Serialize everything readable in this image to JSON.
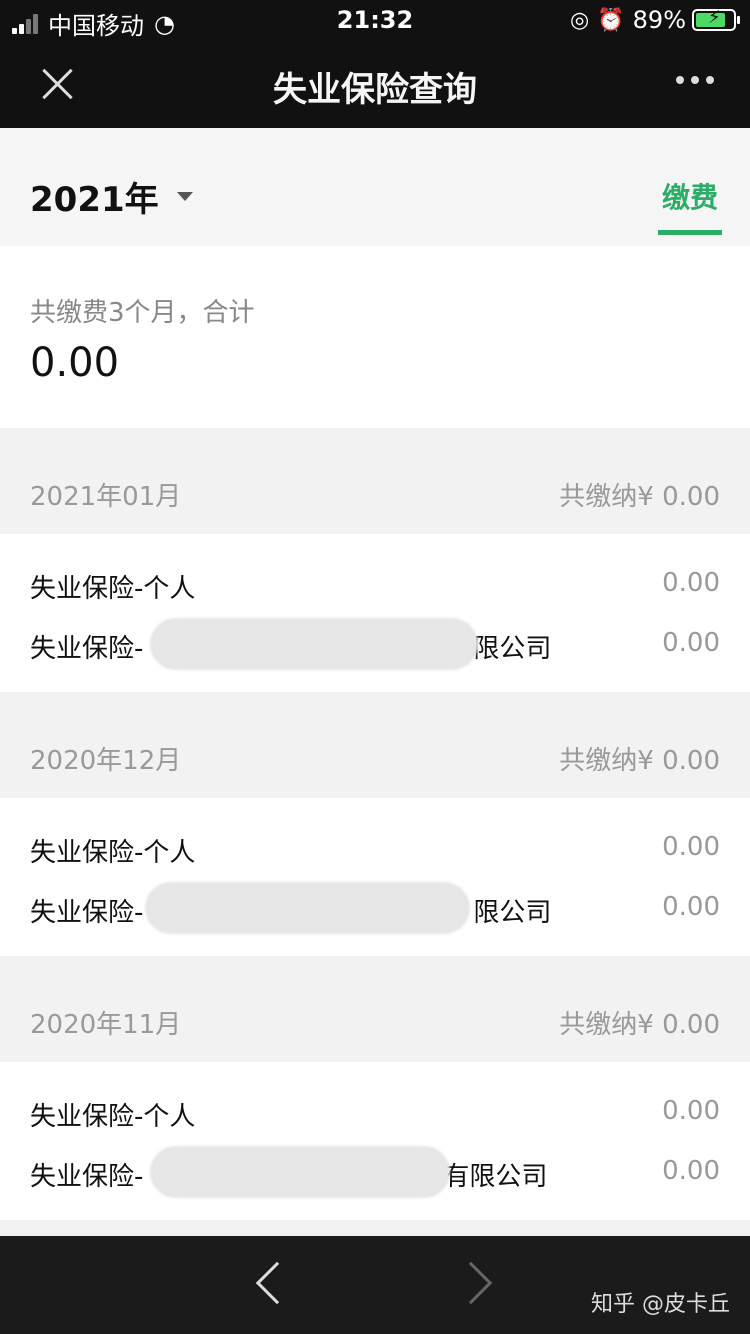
{
  "status_bar": {
    "carrier": "中国移动",
    "time": "21:32",
    "battery": "89%"
  },
  "nav": {
    "title": "失业保险查询"
  },
  "year_bar": {
    "year": "2021年",
    "tab_label": "缴费"
  },
  "summary": {
    "caption": "共缴费3个月，合计",
    "total": "0.00"
  },
  "months": [
    {
      "label": "2021年01月",
      "total": "共缴纳¥ 0.00",
      "items": [
        {
          "name": "失业保险-个人",
          "amount": "0.00"
        },
        {
          "name": "失业保险-",
          "suffix": "限公司",
          "amount": "0.00"
        }
      ]
    },
    {
      "label": "2020年12月",
      "total": "共缴纳¥ 0.00",
      "items": [
        {
          "name": "失业保险-个人",
          "amount": "0.00"
        },
        {
          "name": "失业保险-",
          "suffix": "限公司",
          "amount": "0.00"
        }
      ]
    },
    {
      "label": "2020年11月",
      "total": "共缴纳¥ 0.00",
      "items": [
        {
          "name": "失业保险-个人",
          "amount": "0.00"
        },
        {
          "name": "失业保险-",
          "suffix": "有限公司",
          "amount": "0.00"
        }
      ]
    }
  ],
  "watermark": "知乎 @皮卡丘",
  "colors": {
    "accent": "#2aae67",
    "nav_bg": "#111111"
  }
}
